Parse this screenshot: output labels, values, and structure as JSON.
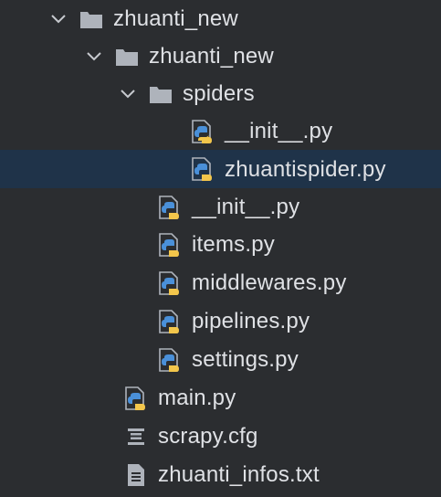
{
  "tree": {
    "items": [
      {
        "label": "zhuanti_new",
        "type": "folder",
        "expanded": true,
        "icon": "folder-icon"
      },
      {
        "label": "zhuanti_new",
        "type": "folder",
        "expanded": true,
        "icon": "folder-icon"
      },
      {
        "label": "spiders",
        "type": "folder",
        "expanded": true,
        "icon": "folder-icon"
      },
      {
        "label": "__init__.py",
        "type": "python",
        "icon": "python-file-icon"
      },
      {
        "label": "zhuantispider.py",
        "type": "python",
        "icon": "python-file-icon",
        "selected": true
      },
      {
        "label": "__init__.py",
        "type": "python",
        "icon": "python-file-icon"
      },
      {
        "label": "items.py",
        "type": "python",
        "icon": "python-file-icon"
      },
      {
        "label": "middlewares.py",
        "type": "python",
        "icon": "python-file-icon"
      },
      {
        "label": "pipelines.py",
        "type": "python",
        "icon": "python-file-icon"
      },
      {
        "label": "settings.py",
        "type": "python",
        "icon": "python-file-icon"
      },
      {
        "label": "main.py",
        "type": "python",
        "icon": "python-file-icon"
      },
      {
        "label": "scrapy.cfg",
        "type": "config",
        "icon": "config-file-icon"
      },
      {
        "label": "zhuanti_infos.txt",
        "type": "text",
        "icon": "text-file-icon"
      }
    ]
  },
  "colors": {
    "background": "#2b2d30",
    "selected_row": "#1f3349",
    "text": "#dfe1e5",
    "folder": "#aeb3bb",
    "chevron": "#c7cacf",
    "python_blue": "#4a90d9",
    "python_yellow": "#f3c64b"
  }
}
